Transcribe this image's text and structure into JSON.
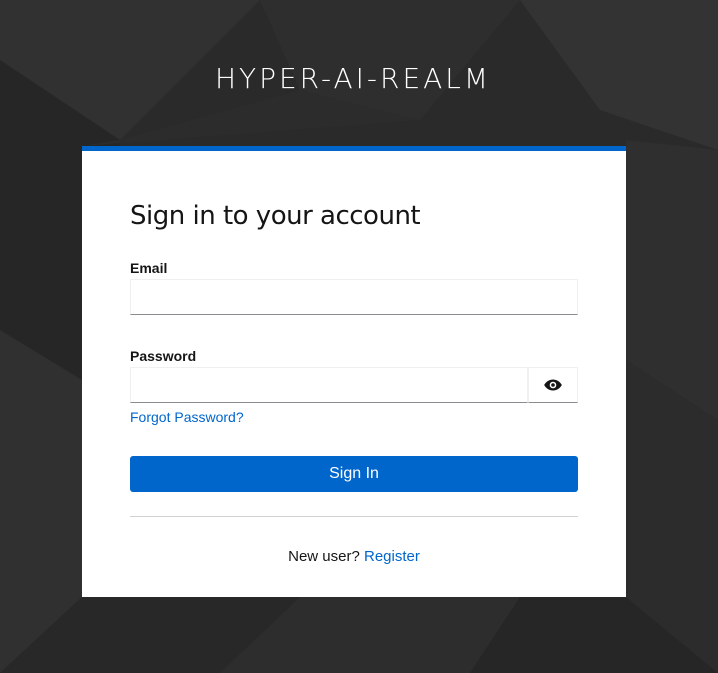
{
  "realm": {
    "title": "HYPER-AI-REALM"
  },
  "login": {
    "title": "Sign in to your account",
    "email_label": "Email",
    "email_value": "",
    "password_label": "Password",
    "password_value": "",
    "forgot_password": "Forgot Password?",
    "sign_in_label": "Sign In",
    "new_user_text": "New user?",
    "register_label": "Register"
  },
  "icons": {
    "show_password": "eye-icon"
  },
  "colors": {
    "accent": "#0066cc",
    "background": "#2b2b2b",
    "card": "#ffffff",
    "text": "#151515"
  }
}
